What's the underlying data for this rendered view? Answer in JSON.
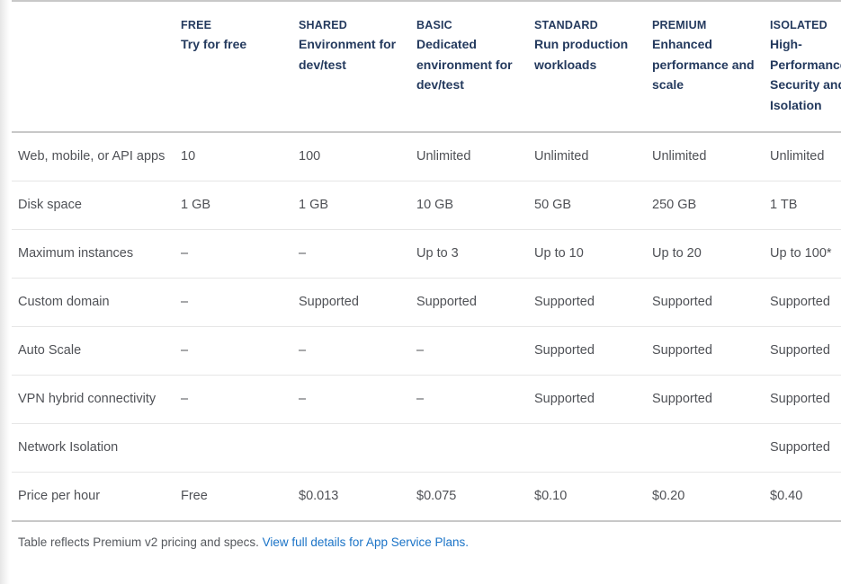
{
  "table": {
    "columns": [
      {
        "tier": "",
        "desc": ""
      },
      {
        "tier": "FREE",
        "desc": "Try for free"
      },
      {
        "tier": "SHARED",
        "desc": "Environment for dev/test"
      },
      {
        "tier": "BASIC",
        "desc": "Dedicated environment for dev/test"
      },
      {
        "tier": "STANDARD",
        "desc": "Run production workloads"
      },
      {
        "tier": "PREMIUM",
        "desc": "Enhanced performance and scale"
      },
      {
        "tier": "ISOLATED",
        "desc": "High-Performance, Security and Isolation"
      }
    ],
    "rows": [
      {
        "label": "Web, mobile, or API apps",
        "values": [
          "10",
          "100",
          "Unlimited",
          "Unlimited",
          "Unlimited",
          "Unlimited"
        ]
      },
      {
        "label": "Disk space",
        "values": [
          "1 GB",
          "1 GB",
          "10 GB",
          "50 GB",
          "250 GB",
          "1 TB"
        ]
      },
      {
        "label": "Maximum instances",
        "values": [
          "–",
          "–",
          "Up to 3",
          "Up to 10",
          "Up to 20",
          "Up to 100*"
        ]
      },
      {
        "label": "Custom domain",
        "values": [
          "–",
          "Supported",
          "Supported",
          "Supported",
          "Supported",
          "Supported"
        ]
      },
      {
        "label": "Auto Scale",
        "values": [
          "–",
          "–",
          "–",
          "Supported",
          "Supported",
          "Supported"
        ]
      },
      {
        "label": "VPN hybrid connectivity",
        "values": [
          "–",
          "–",
          "–",
          "Supported",
          "Supported",
          "Supported"
        ]
      },
      {
        "label": "Network Isolation",
        "values": [
          "",
          "",
          "",
          "",
          "",
          "Supported"
        ]
      },
      {
        "label": "Price per hour",
        "values": [
          "Free",
          "$0.013",
          "$0.075",
          "$0.10",
          "$0.20",
          "$0.40"
        ]
      }
    ]
  },
  "footnote": {
    "text": "Table reflects Premium v2 pricing and specs. ",
    "link_text": "View full details for App Service Plans."
  },
  "colors": {
    "header_text": "#243a5e",
    "body_text": "#4f5156",
    "link": "#1a73c7",
    "rule_strong": "#c8c8c8",
    "rule_light": "#e6e6e6"
  }
}
